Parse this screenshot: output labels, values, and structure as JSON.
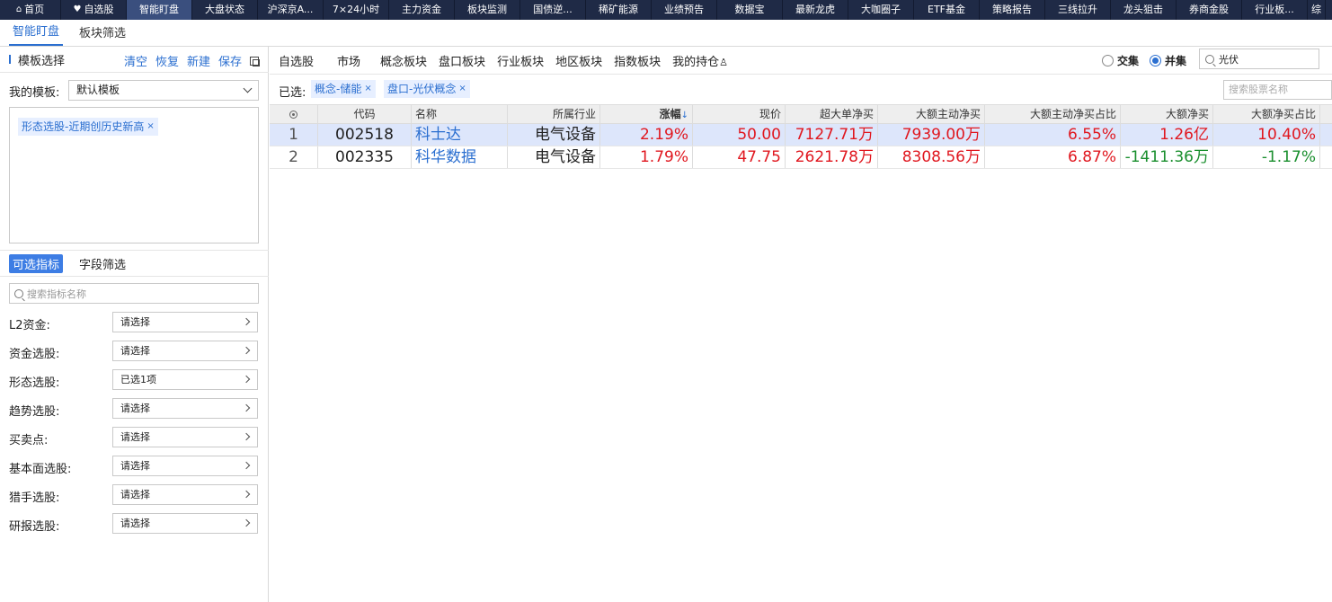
{
  "topnav": {
    "items": [
      {
        "label": "首页",
        "icon": "home-icon",
        "width": 68
      },
      {
        "label": "自选股",
        "icon": "heart-icon",
        "width": 73
      },
      {
        "label": "智能盯盘",
        "active": true,
        "width": 73
      },
      {
        "label": "大盘状态",
        "width": 73
      },
      {
        "label": "沪深京A...",
        "width": 73
      },
      {
        "label": "7×24小时",
        "width": 73
      },
      {
        "label": "主力资金",
        "width": 73
      },
      {
        "label": "板块监测",
        "width": 73
      },
      {
        "label": "国债逆...",
        "width": 73
      },
      {
        "label": "稀矿能源",
        "width": 73
      },
      {
        "label": "业绩预告",
        "width": 73
      },
      {
        "label": "数据宝",
        "width": 73
      },
      {
        "label": "最新龙虎",
        "width": 73
      },
      {
        "label": "大咖圈子",
        "width": 73
      },
      {
        "label": "ETF基金",
        "width": 73
      },
      {
        "label": "策略报告",
        "width": 73
      },
      {
        "label": "三线拉升",
        "width": 73
      },
      {
        "label": "龙头狙击",
        "width": 73
      },
      {
        "label": "券商金股",
        "width": 73
      },
      {
        "label": "行业板...",
        "width": 73
      },
      {
        "label": "综",
        "width": 20
      }
    ]
  },
  "subtabs": [
    "智能盯盘",
    "板块筛选"
  ],
  "template": {
    "title": "模板选择",
    "actions": [
      "清空",
      "恢复",
      "新建",
      "保存"
    ],
    "my_label": "我的模板:",
    "my_value": "默认模板",
    "tags": [
      "形态选股-近期创历史新高"
    ]
  },
  "indicator_tabs": [
    "可选指标",
    "字段筛选"
  ],
  "indicator_search_placeholder": "搜索指标名称",
  "indicators": [
    {
      "label": "L2资金:",
      "value": "请选择"
    },
    {
      "label": "资金选股:",
      "value": "请选择"
    },
    {
      "label": "形态选股:",
      "value": "已选1项"
    },
    {
      "label": "趋势选股:",
      "value": "请选择"
    },
    {
      "label": "买卖点:",
      "value": "请选择"
    },
    {
      "label": "基本面选股:",
      "value": "请选择"
    },
    {
      "label": "猎手选股:",
      "value": "请选择"
    },
    {
      "label": "研报选股:",
      "value": "请选择"
    }
  ],
  "market_tabs": [
    "自选股",
    "市场",
    "概念板块",
    "盘口板块",
    "行业板块",
    "地区板块",
    "指数板块",
    "我的持仓"
  ],
  "set_mode": {
    "intersect": "交集",
    "union": "并集",
    "selected": "union"
  },
  "top_search_value": "光伏",
  "selected": {
    "label": "已选:",
    "tags": [
      "概念-储能",
      "盘口-光伏概念"
    ]
  },
  "stock_search_placeholder": "搜索股票名称",
  "table": {
    "headers": [
      "代码",
      "名称",
      "所属行业",
      "涨幅",
      "现价",
      "超大单净买",
      "大额主动净买",
      "大额主动净买占比",
      "大额净买",
      "大额净买占比"
    ],
    "sort_arrow": "↓",
    "rows": [
      {
        "idx": "1",
        "code": "002518",
        "name": "科士达",
        "industry": "电气设备",
        "change": "2.19%",
        "price": "50.00",
        "xl_net": "7127.71万",
        "big_active": "7939.00万",
        "big_active_pct": "6.55%",
        "big_net": "1.26亿",
        "big_net_pct": "10.40%",
        "big_net_dir": "up",
        "big_net_pct_dir": "up"
      },
      {
        "idx": "2",
        "code": "002335",
        "name": "科华数据",
        "industry": "电气设备",
        "change": "1.79%",
        "price": "47.75",
        "xl_net": "2621.78万",
        "big_active": "8308.56万",
        "big_active_pct": "6.87%",
        "big_net": "-1411.36万",
        "big_net_pct": "-1.17%",
        "big_net_dir": "down",
        "big_net_pct_dir": "down"
      }
    ]
  }
}
